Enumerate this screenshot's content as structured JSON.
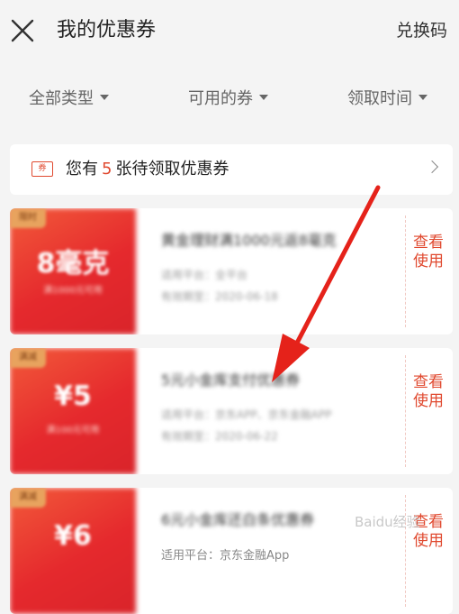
{
  "header": {
    "title": "我的优惠券",
    "redeem_label": "兑换码"
  },
  "filters": [
    {
      "label": "全部类型"
    },
    {
      "label": "可用的券"
    },
    {
      "label": "领取时间"
    }
  ],
  "pending": {
    "prefix": "您有",
    "count": "5",
    "suffix": "张待领取优惠券",
    "icon_text": "券"
  },
  "coupons": [
    {
      "tag": "限时",
      "amount": "8毫克",
      "condition": "满1000元可用",
      "name": "黄金理财满1000元返8毫克",
      "platform": "适用平台：全平台",
      "validity": "有效期至：2020-06-18",
      "use_label": "查看使用"
    },
    {
      "tag": "满减",
      "amount": "¥5",
      "condition": "满100元可用",
      "name": "5元小金库支付优惠券",
      "platform": "适用平台：京东APP、京东金融APP",
      "validity": "有效期至：2020-06-22",
      "use_label": "查看使用"
    },
    {
      "tag": "满减",
      "amount": "¥6",
      "condition": "",
      "name": "6元小金库还白条优惠券",
      "platform": "适用平台：京东金融App",
      "validity": "",
      "use_label": "查看使用"
    }
  ],
  "watermark_text": "Baidu经验",
  "colors": {
    "accent": "#e0492f",
    "arrow": "#e5221a"
  }
}
